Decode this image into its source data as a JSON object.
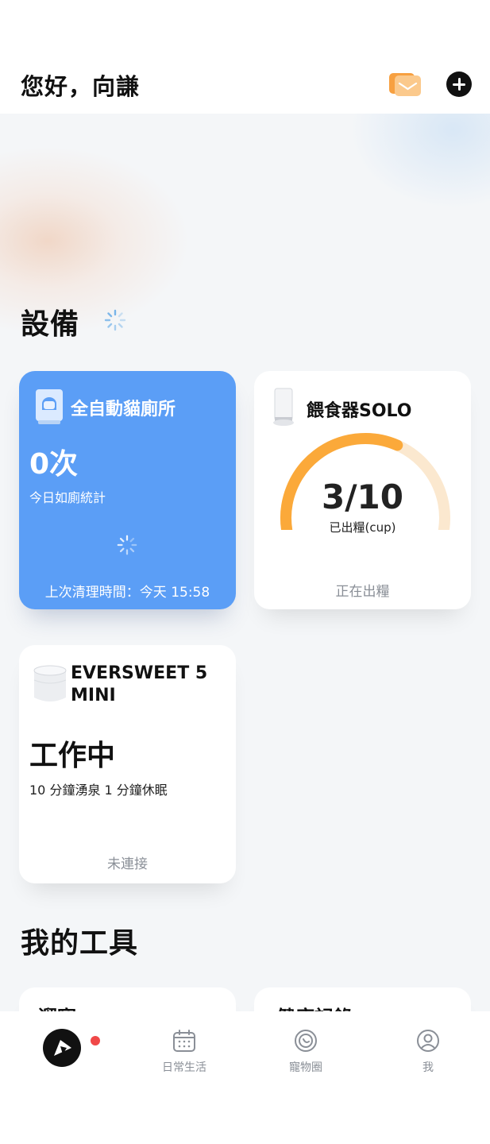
{
  "header": {
    "greeting": "您好，向謙",
    "mail_icon": "mail-icon",
    "add_icon": "plus-icon"
  },
  "devices": {
    "section_title": "設備",
    "litter_box": {
      "name": "全自動貓廁所",
      "count": "0次",
      "count_label": "今日如廁統計",
      "last_clean": "上次清理時間：今天 15:58",
      "accent": "#5b9ef6"
    },
    "feeder": {
      "name": "餵食器SOLO",
      "progress_value": 3,
      "progress_max": 10,
      "progress_text": "3/10",
      "unit_label": "已出糧(cup)",
      "status": "正在出糧",
      "gauge_color": "#fba93a",
      "track_color": "#fbe8cf"
    },
    "fountain": {
      "name_line1": "EVERSWEET 5",
      "name_line2": "MINI",
      "state": "工作中",
      "mode": "10 分鐘湧泉 1 分鐘休眠",
      "connection": "未連接"
    }
  },
  "tools": {
    "section_title": "我的工具",
    "card_left_partial": "遛寵",
    "card_right_partial": "健康記錄"
  },
  "nav": {
    "items": [
      {
        "label": "",
        "icon": "home-logo-icon"
      },
      {
        "label": "日常生活",
        "icon": "calendar-icon"
      },
      {
        "label": "寵物圈",
        "icon": "pet-circle-icon"
      },
      {
        "label": "我",
        "icon": "profile-icon"
      }
    ],
    "notification_color": "#f04848"
  }
}
